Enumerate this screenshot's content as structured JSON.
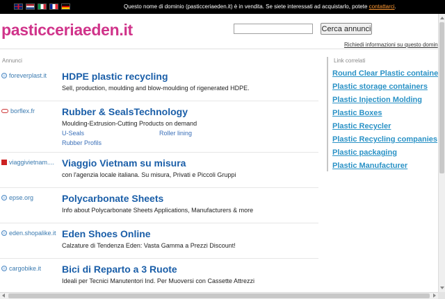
{
  "topbar": {
    "flags": [
      "flag-uk-icon",
      "flag-nl-icon",
      "flag-it-icon",
      "flag-fr-icon",
      "flag-de-icon"
    ],
    "notice": "Questo nome di dominio (pasticceriaeden.it) è in vendita. Se siete interessati ad acquistarlo, potete ",
    "contact_link": "contattarci",
    "notice_end": "."
  },
  "header": {
    "logo": "pasticceriaeden.it",
    "search_value": "",
    "search_button": "Cerca annunci",
    "info_link": "Richiedi informazioni su questo domin"
  },
  "ads_label": "Annunci",
  "ads": [
    {
      "domain": "foreverplast.it",
      "icon": "globe-icon",
      "title": "HDPE plastic recycling",
      "desc": "Sell, production, moulding and blow-moulding of rigenerated HDPE."
    },
    {
      "domain": "borflex.fr",
      "icon": "chain-link-icon",
      "title": "Rubber & SealsTechnology",
      "desc": "Moulding-Extrusion-Cutting Products on demand",
      "sublinks": [
        "U-Seals",
        "Roller lining",
        "Rubber Profils"
      ]
    },
    {
      "domain": "viaggivietnam....",
      "icon": "red-logo-icon",
      "title": "Viaggio Vietnam su misura",
      "desc": "con l'agenzia locale italiana. Su misura, Privati e Piccoli Gruppi"
    },
    {
      "domain": "epse.org",
      "icon": "globe-icon",
      "title": "Polycarbonate Sheets",
      "desc": "Info about Polycarbonate Sheets Applications, Manufacturers & more"
    },
    {
      "domain": "eden.shopalike.it",
      "icon": "globe-icon",
      "title": "Eden Shoes Online",
      "desc": "Calzature di Tendenza Eden: Vasta Gamma a Prezzi Discount!"
    },
    {
      "domain": "cargobike.it",
      "icon": "globe-icon",
      "title": "Bici di Reparto a 3 Ruote",
      "desc": "Ideali per Tecnici Manutentori Ind. Per Muoversi con Cassette Attrezzi"
    }
  ],
  "related": {
    "label": "Link correlati",
    "links": [
      "Round Clear Plastic containers",
      "Plastic storage containers",
      "Plastic Injection Molding",
      "Plastic Boxes",
      "Plastic Recycler",
      "Plastic Recycling companies",
      "Plastic packaging",
      "Plastic Manufacturer"
    ]
  },
  "colors": {
    "logo": "#d0338a",
    "ad_title": "#1a5ea8",
    "related_link": "#2a92c6",
    "contact_link": "#ff9933"
  }
}
